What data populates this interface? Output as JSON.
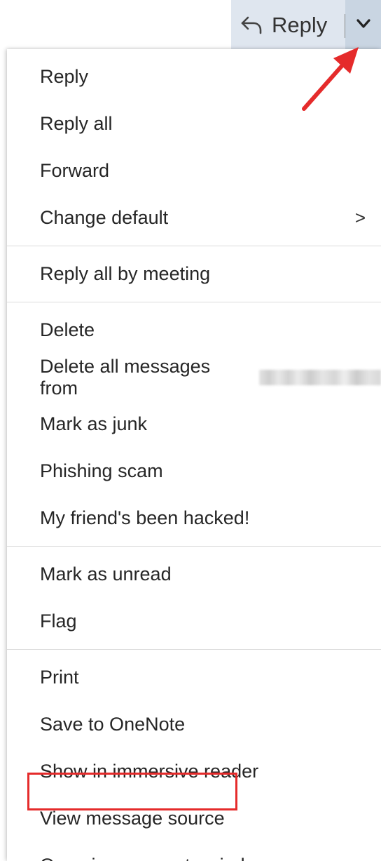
{
  "toolbar": {
    "reply_label": "Reply",
    "reply_icon": "reply-arrow-icon",
    "dropdown_icon": "chevron-down-icon",
    "bg_color": "#dfe6ef",
    "dropdown_bg_color": "#c9d5e2"
  },
  "menu": {
    "groups": [
      {
        "items": [
          {
            "label": "Reply"
          },
          {
            "label": "Reply all"
          },
          {
            "label": "Forward"
          },
          {
            "label": "Change default",
            "submenu_icon": ">"
          }
        ]
      },
      {
        "items": [
          {
            "label": "Reply all by meeting"
          }
        ]
      },
      {
        "items": [
          {
            "label": "Delete"
          },
          {
            "label": "Delete all messages from"
          },
          {
            "label": "Mark as junk"
          },
          {
            "label": "Phishing scam"
          },
          {
            "label": "My friend's been hacked!"
          }
        ]
      },
      {
        "items": [
          {
            "label": "Mark as unread"
          },
          {
            "label": "Flag"
          }
        ]
      },
      {
        "items": [
          {
            "label": "Print"
          },
          {
            "label": "Save to OneNote"
          },
          {
            "label": "Show in immersive reader"
          },
          {
            "label": "View message source"
          },
          {
            "label": "Open in a separate window"
          }
        ]
      }
    ]
  },
  "annotations": {
    "arrow_color": "#e52b2b",
    "highlight_color": "#e52b2b"
  }
}
